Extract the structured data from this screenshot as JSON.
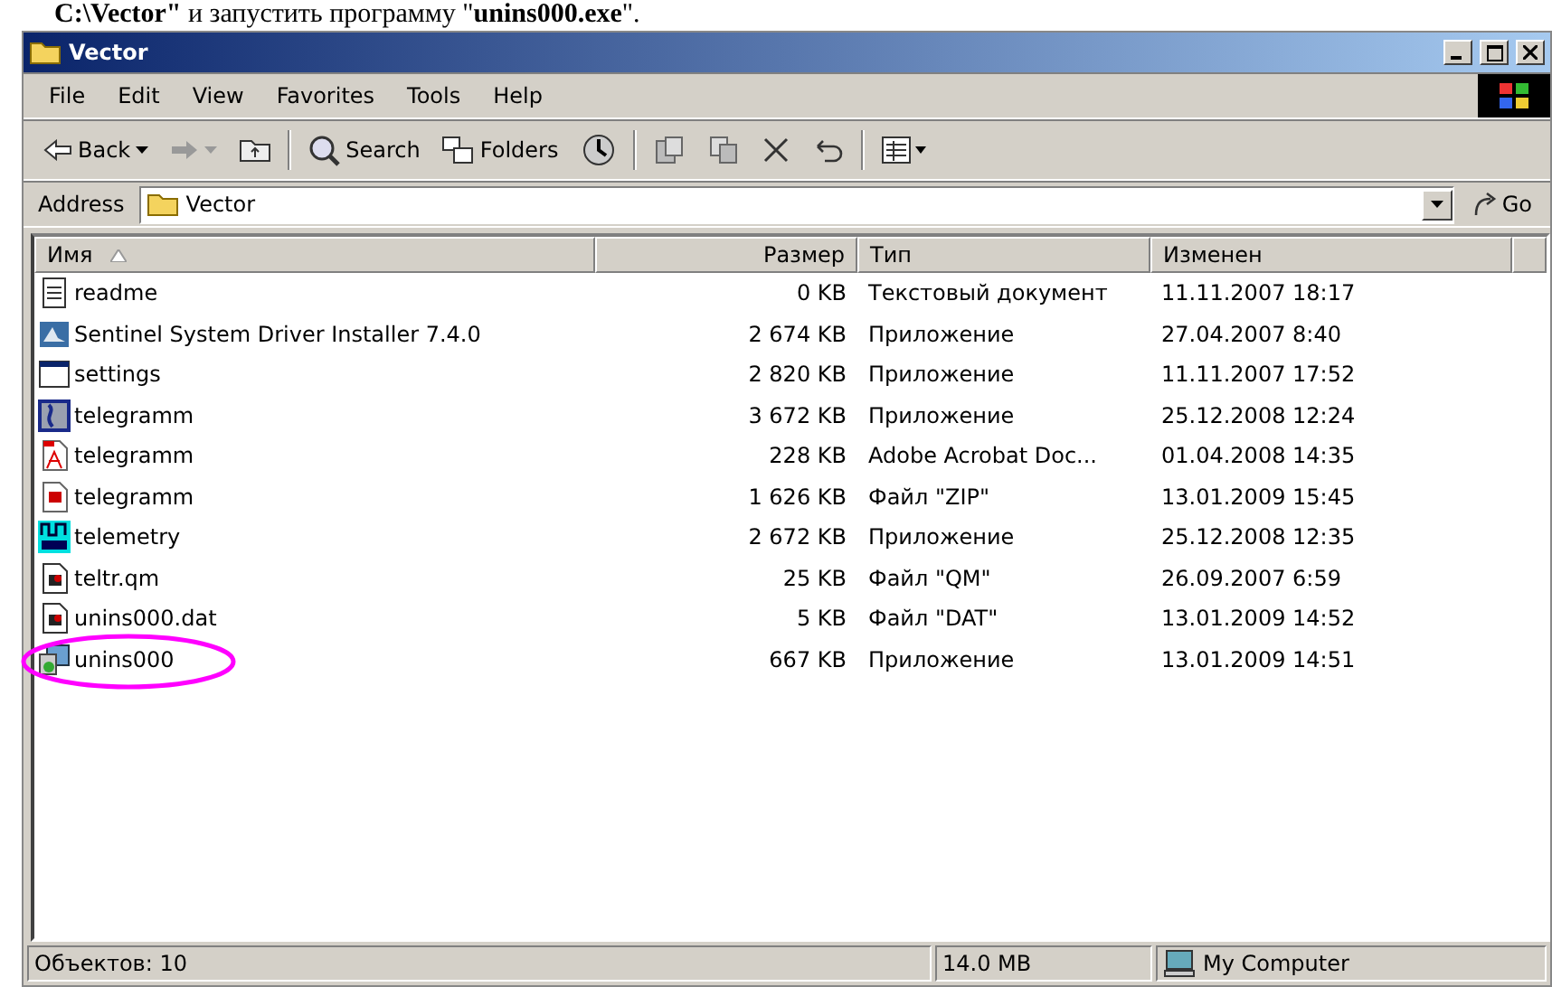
{
  "caption": "**C:\\Vector\"** и запустить программу \"**unins000.exe**\".",
  "window": {
    "title": "Vector"
  },
  "menu": [
    "File",
    "Edit",
    "View",
    "Favorites",
    "Tools",
    "Help"
  ],
  "toolbar": {
    "back": "Back",
    "search": "Search",
    "folders": "Folders"
  },
  "address": {
    "label": "Address",
    "value": "Vector",
    "go": "Go"
  },
  "columns": [
    {
      "label": "Имя",
      "sorted": true
    },
    {
      "label": "Размер",
      "sorted": false
    },
    {
      "label": "Тип",
      "sorted": false
    },
    {
      "label": "Изменен",
      "sorted": false
    }
  ],
  "rows": [
    {
      "kind": "text",
      "name": "readme",
      "size": "0 KB",
      "type": "Текстовый документ",
      "modified": "11.11.2007 18:17",
      "highlighted": false
    },
    {
      "kind": "installer",
      "name": "Sentinel System Driver Installer 7.4.0",
      "size": "2 674 KB",
      "type": "Приложение",
      "modified": "27.04.2007 8:40",
      "highlighted": false
    },
    {
      "kind": "window",
      "name": "settings",
      "size": "2 820 KB",
      "type": "Приложение",
      "modified": "11.11.2007 17:52",
      "highlighted": false
    },
    {
      "kind": "app",
      "name": "telegramm",
      "size": "3 672 KB",
      "type": "Приложение",
      "modified": "25.12.2008 12:24",
      "highlighted": false
    },
    {
      "kind": "pdf",
      "name": "telegramm",
      "size": "228 KB",
      "type": "Adobe Acrobat Doc...",
      "modified": "01.04.2008 14:35",
      "highlighted": false
    },
    {
      "kind": "zip",
      "name": "telegramm",
      "size": "1 626 KB",
      "type": "Файл \"ZIP\"",
      "modified": "13.01.2009 15:45",
      "highlighted": false
    },
    {
      "kind": "meter",
      "name": "telemetry",
      "size": "2 672 KB",
      "type": "Приложение",
      "modified": "25.12.2008 12:35",
      "highlighted": false
    },
    {
      "kind": "file",
      "name": "teltr.qm",
      "size": "25 KB",
      "type": "Файл \"QM\"",
      "modified": "26.09.2007 6:59",
      "highlighted": false
    },
    {
      "kind": "file",
      "name": "unins000.dat",
      "size": "5 KB",
      "type": "Файл \"DAT\"",
      "modified": "13.01.2009 14:52",
      "highlighted": false
    },
    {
      "kind": "setup",
      "name": "unins000",
      "size": "667 KB",
      "type": "Приложение",
      "modified": "13.01.2009 14:51",
      "highlighted": true
    }
  ],
  "status_bar": {
    "objects": "Объектов: 10",
    "size": "14.0 MB",
    "zone": "My Computer"
  }
}
